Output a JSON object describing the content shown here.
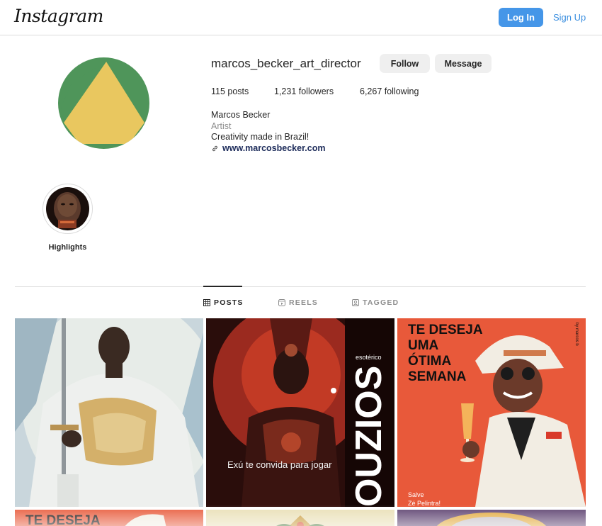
{
  "header": {
    "logo_text": "Instagram",
    "login_label": "Log In",
    "signup_label": "Sign Up",
    "accent_color": "#4596e8"
  },
  "profile": {
    "username": "marcos_becker_art_director",
    "follow_label": "Follow",
    "message_label": "Message",
    "posts": "115 posts",
    "followers": "1,231 followers",
    "following": "6,267 following",
    "full_name": "Marcos Becker",
    "category": "Artist",
    "bio": "Creativity made in Brazil!",
    "website": "www.marcosbecker.com",
    "avatar_colors": {
      "background": "#4f955a",
      "triangle": "#e9c75f"
    }
  },
  "highlights": [
    {
      "label": "Highlights"
    }
  ],
  "tabs": [
    {
      "label": "POSTS",
      "icon": "grid-icon",
      "active": true
    },
    {
      "label": "REELS",
      "icon": "reels-icon",
      "active": false
    },
    {
      "label": "TAGGED",
      "icon": "tagged-icon",
      "active": false
    }
  ],
  "posts": [
    {
      "kind": "painting",
      "description_icon": "warrior-with-sword-image"
    },
    {
      "kind": "poster",
      "side_text": "OUZIOS",
      "tag": "esotérico",
      "caption": "Exú te convida para jogar"
    },
    {
      "kind": "poster",
      "headline": [
        "TE DESEJA",
        "UMA",
        "ÓTIMA",
        "SEMANA"
      ],
      "vertical_credit": "by marcos b",
      "footer": [
        "Salve",
        "Zé Pelintra!"
      ]
    },
    {
      "kind": "poster",
      "headline": [
        "TE DESEJA"
      ]
    },
    {
      "kind": "painting",
      "description_icon": "flowers-image"
    },
    {
      "kind": "painting",
      "description_icon": "portrait-image"
    }
  ]
}
